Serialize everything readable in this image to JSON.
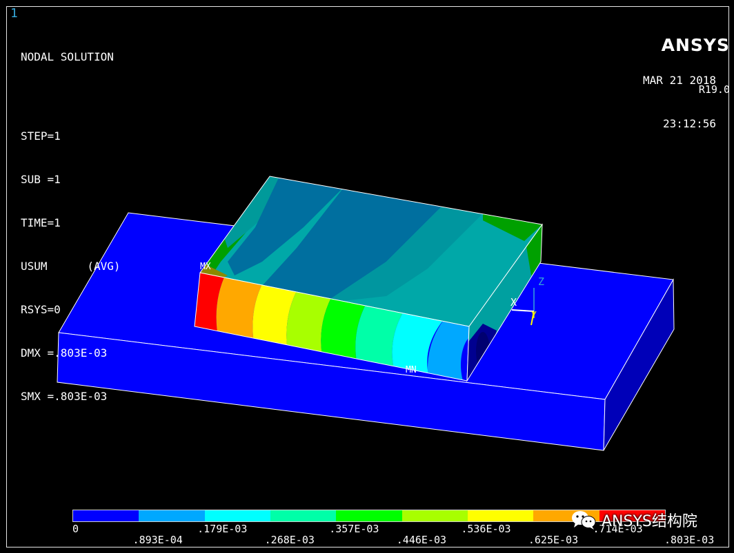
{
  "window_number": "1",
  "info_lines": [
    "NODAL SOLUTION",
    "STEP=1",
    "SUB =1",
    "TIME=1",
    "USUM      (AVG)",
    "RSYS=0",
    "DMX =.803E-03",
    "SMX =.803E-03"
  ],
  "brand": {
    "name": "ANSYS",
    "version": "R19.0"
  },
  "timestamp": {
    "date": "MAR 21 2018",
    "time": "23:12:56"
  },
  "markers": {
    "max": "MX",
    "min": "MN"
  },
  "triad": {
    "z": "Z",
    "x": "X",
    "y": "Y"
  },
  "legend": {
    "colors": [
      "#0000ff",
      "#00a8ff",
      "#00ffff",
      "#00ffa8",
      "#00ff00",
      "#a8ff00",
      "#ffff00",
      "#ffa800",
      "#ff0000"
    ],
    "top_labels": [
      "0",
      ".179E-03",
      ".357E-03",
      ".536E-03",
      ".714E-03"
    ],
    "bottom_labels": [
      ".893E-04",
      ".268E-03",
      ".446E-03",
      ".625E-03",
      ".803E-03"
    ]
  },
  "watermark": {
    "text": "ANSYS结构院",
    "icon": "wechat-icon"
  }
}
